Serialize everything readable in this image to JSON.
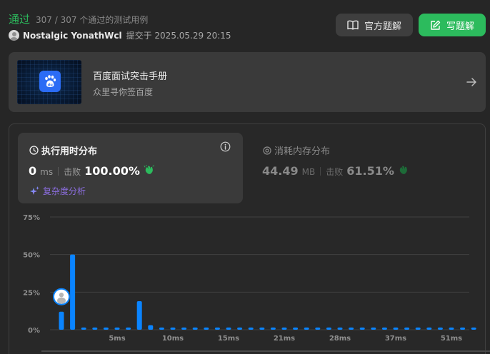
{
  "status": {
    "title": "通过",
    "count": "307 / 307 个通过的测试用例"
  },
  "submission": {
    "user": "Nostalgic YonathWcl",
    "submitted_text": "提交于 2025.05.29 20:15"
  },
  "buttons": {
    "official_solution": "官方题解",
    "write_solution": "写题解"
  },
  "promo": {
    "title": "百度面试突击手册",
    "subtitle": "众里寻你签百度"
  },
  "runtime": {
    "title": "执行用时分布",
    "value": "0",
    "unit": "ms",
    "beat_label": "击败",
    "beat_value": "100.00%",
    "complexity_link": "复杂度分析"
  },
  "memory": {
    "title": "消耗内存分布",
    "value": "44.49",
    "unit": "MB",
    "beat_label": "击败",
    "beat_value": "61.51%"
  },
  "colors": {
    "accepted_green": "#2cbb5d",
    "bar_blue": "#0a84ff",
    "complexity_purple": "#8c6ee0"
  },
  "chart_data": {
    "type": "bar",
    "y_ticks": [
      "75%",
      "50%",
      "25%",
      "0%"
    ],
    "ylim": [
      0,
      75
    ],
    "x_tick_labels": [
      "5ms",
      "10ms",
      "15ms",
      "21ms",
      "28ms",
      "37ms",
      "51ms"
    ],
    "x_tick_bar_index": [
      5,
      10,
      15,
      20,
      25,
      30,
      35
    ],
    "values": [
      12,
      50,
      1.5,
      1.5,
      1.5,
      1.5,
      1.5,
      19,
      3,
      1.5,
      1.5,
      1.5,
      1.5,
      1.5,
      1.5,
      1.5,
      1.5,
      1.5,
      1.5,
      1.5,
      1.5,
      1.5,
      1.5,
      1.5,
      1.5,
      1.5,
      1.5,
      1.5,
      1.5,
      1.5,
      1.5,
      1.5,
      1.5,
      1.5,
      1.5,
      1.5,
      1.5,
      1.5
    ],
    "user_bar_index": 0,
    "grid": true
  }
}
